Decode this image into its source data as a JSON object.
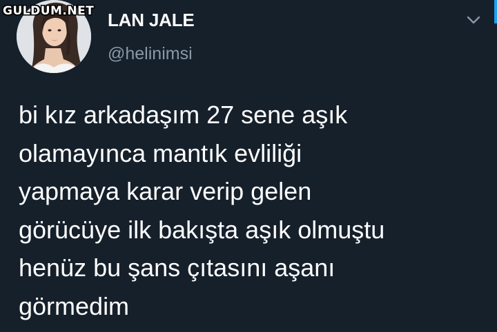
{
  "watermark": "GULDUM.NET",
  "tweet": {
    "display_name": "LAN JALE",
    "handle": "@helinimsi",
    "lines": [
      "bi kız arkadaşım 27 sene aşık",
      "olamayınca mantık evliliği",
      "yapmaya karar verip gelen",
      "görücüye ilk bakışta aşık olmuştu",
      "henüz bu şans çıtasını aşanı",
      "görmedim"
    ]
  },
  "icons": {
    "menu": "chevron-down-icon"
  },
  "colors": {
    "background": "#16202b",
    "text": "#ffffff",
    "secondary_text": "#8a99a6",
    "accent": "#1da1f2"
  }
}
